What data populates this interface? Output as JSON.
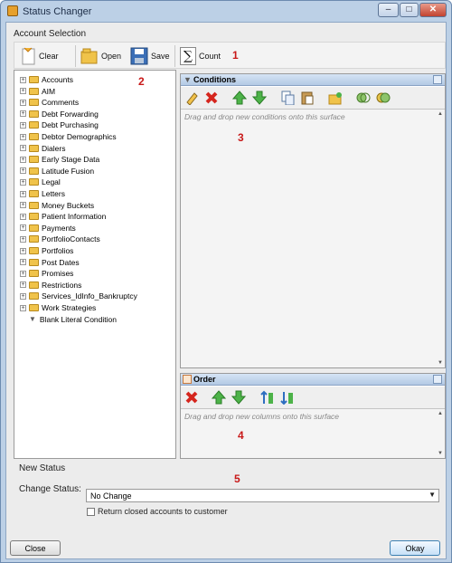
{
  "window": {
    "title": "Status Changer",
    "minimize": "–",
    "maximize": "□",
    "close": "✕"
  },
  "account_selection": {
    "label": "Account Selection",
    "toolbar": {
      "clear": "Clear",
      "open": "Open",
      "save": "Save",
      "count": "Count"
    },
    "callout": "1"
  },
  "tree": {
    "callout": "2",
    "items": [
      "Accounts",
      "AIM",
      "Comments",
      "Debt Forwarding",
      "Debt Purchasing",
      "Debtor Demographics",
      "Dialers",
      "Early Stage Data",
      "Latitude Fusion",
      "Legal",
      "Letters",
      "Money Buckets",
      "Patient Information",
      "Payments",
      "PortfolioContacts",
      "Portfolios",
      "Post Dates",
      "Promises",
      "Restrictions",
      "Services_IdInfo_Bankruptcy",
      "Work Strategies"
    ],
    "leaf": "Blank Literal Condition"
  },
  "conditions": {
    "title": "Conditions",
    "hint": "Drag and drop new conditions onto this surface",
    "callout": "3"
  },
  "order": {
    "title": "Order",
    "hint": "Drag and drop new columns onto this surface",
    "callout": "4"
  },
  "new_status": {
    "label": "New Status",
    "callout": "5",
    "change_label": "Change Status:",
    "change_value": "No Change",
    "return_closed": "Return closed accounts to customer"
  },
  "buttons": {
    "close": "Close",
    "okay": "Okay"
  }
}
